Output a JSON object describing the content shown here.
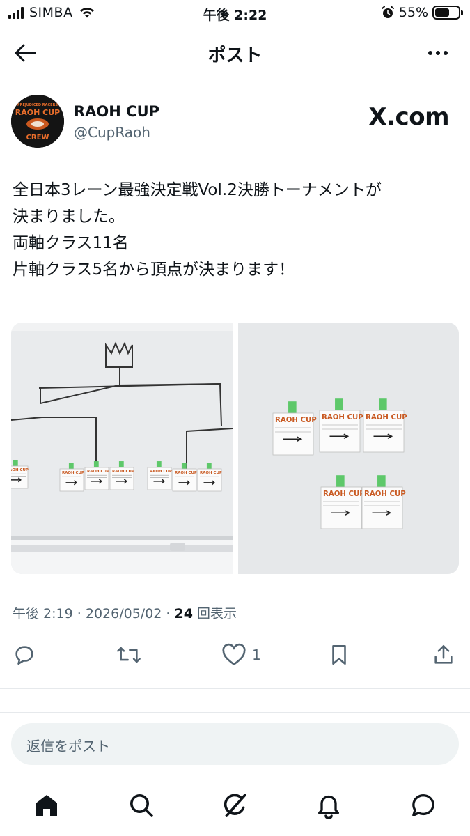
{
  "status_bar": {
    "carrier": "SIMBA",
    "time": "午後 2:22",
    "battery_percent_label": "55%",
    "battery_level": 0.55
  },
  "nav": {
    "title": "ポスト",
    "back_icon": "arrow-left-icon",
    "more_icon": "more-horizontal-icon"
  },
  "author": {
    "name": "RAOH CUP",
    "handle": "@CupRaoh",
    "watermark": "X.com",
    "avatar_text": [
      "PREJUDICED RACERS",
      "RAOH CUP",
      "CREW"
    ]
  },
  "post": {
    "lines": [
      "全日本3レーン最強決定戦Vol.2決勝トーナメントが",
      "決まりました。",
      "両軸クラス11名",
      "片軸クラス5名から頂点が決まります！"
    ]
  },
  "media": {
    "photo1_cards": [
      "RAOH CUP",
      "RAOH CUP",
      "RAOH CUP",
      "RAOH CUP",
      "RAOH CUP",
      "RAOH CUP",
      "RAOH CUP"
    ],
    "photo2_cards": [
      "RAOH CUP",
      "RAOH CUP",
      "RAOH CUP",
      "RAOH CUP",
      "RAOH CUP"
    ]
  },
  "meta": {
    "time": "午後 2:19",
    "separator": "·",
    "date": "2026/05/02",
    "views_count": "24",
    "views_label": "回表示"
  },
  "actions": {
    "reply_icon": "comment-icon",
    "repost_icon": "repost-icon",
    "like_icon": "heart-icon",
    "like_count": "1",
    "bookmark_icon": "bookmark-icon",
    "share_icon": "share-icon"
  },
  "reply_box": {
    "placeholder": "返信をポスト"
  },
  "tabs": [
    {
      "icon": "home-icon"
    },
    {
      "icon": "search-icon"
    },
    {
      "icon": "grok-icon"
    },
    {
      "icon": "bell-icon"
    },
    {
      "icon": "messages-icon"
    }
  ]
}
